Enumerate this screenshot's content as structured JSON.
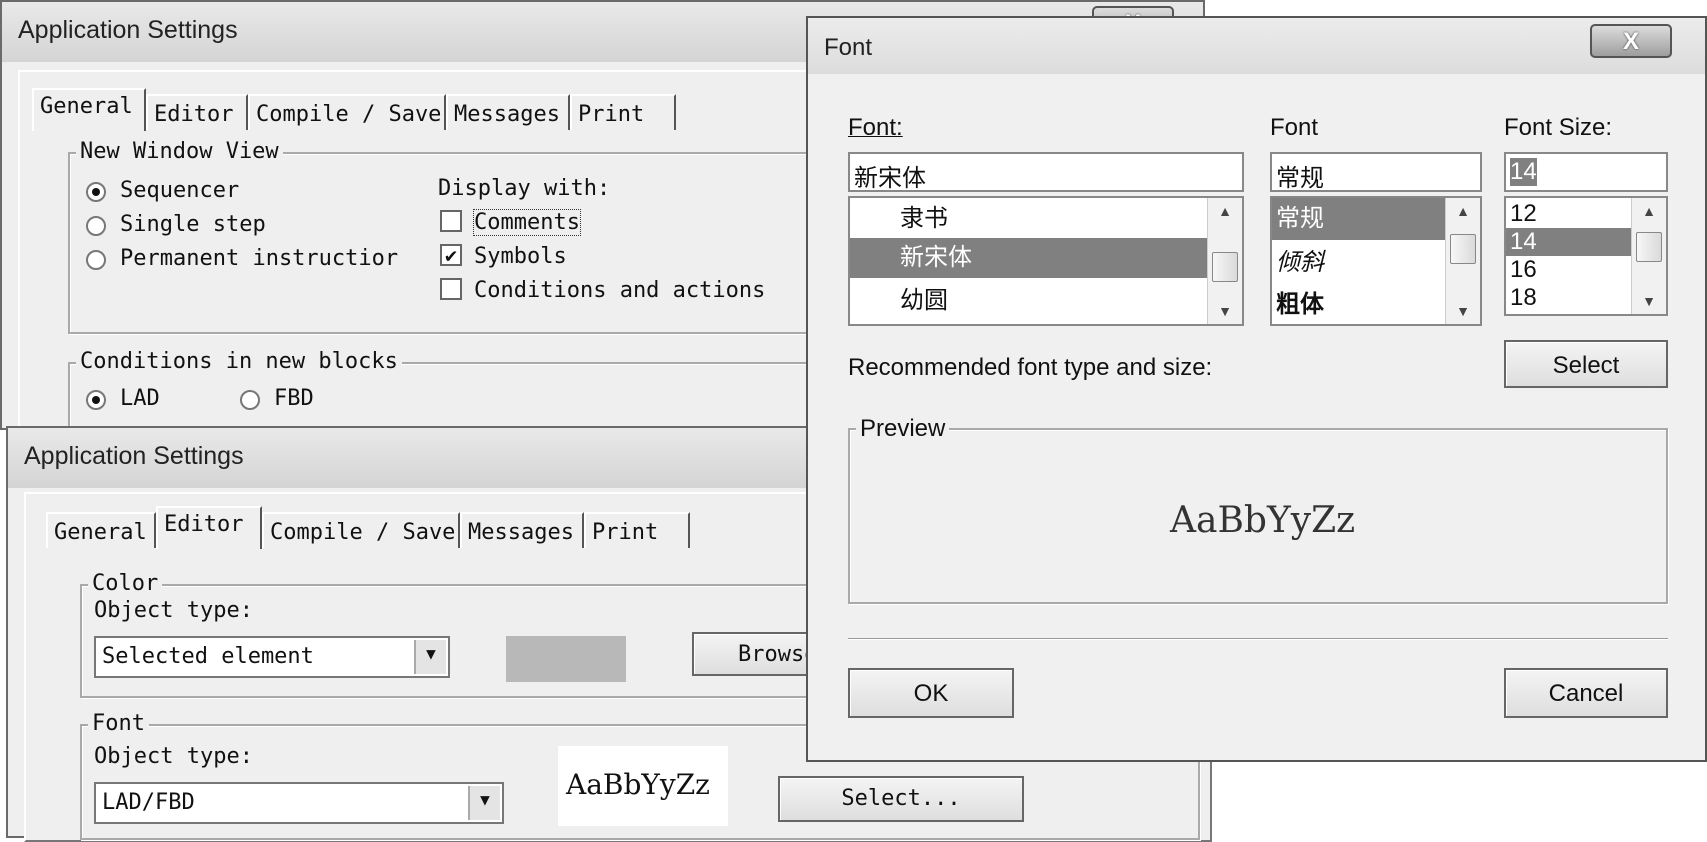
{
  "win1": {
    "title": "Application Settings",
    "tabs": [
      "General",
      "Editor",
      "Compile / Save",
      "Messages",
      "Print"
    ],
    "group_view": "New Window View",
    "radio_sequencer": "Sequencer",
    "radio_single": "Single step",
    "radio_permanent": "Permanent instructior",
    "display_with": "Display with:",
    "chk_comments": "Comments",
    "chk_symbols": "Symbols",
    "chk_conditions": "Conditions and actions",
    "group_conditions": "Conditions in new blocks",
    "radio_lad": "LAD",
    "radio_fbd": "FBD",
    "close": "X"
  },
  "win2": {
    "title": "Application Settings",
    "tabs": [
      "General",
      "Editor",
      "Compile / Save",
      "Messages",
      "Print"
    ],
    "group_color": "Color",
    "object_type_label": "Object type:",
    "color_object_value": "Selected element",
    "browse_button": "Browse...",
    "group_font": "Font",
    "font_object_label": "Object type:",
    "font_object_value": "LAD/FBD",
    "font_sample": "AaBbYyZz",
    "select_button": "Select..."
  },
  "font_dialog": {
    "title": "Font",
    "close": "X",
    "font_label": "Font:",
    "style_label": "Font",
    "size_label": "Font Size:",
    "font_value": "新宋体",
    "style_value": "常规",
    "size_value": "14",
    "font_list": [
      "隶书",
      "新宋体",
      "幼圆"
    ],
    "style_list": [
      "常规",
      "倾斜",
      "粗体"
    ],
    "size_list": [
      "12",
      "14",
      "16",
      "18"
    ],
    "recommended_label": "Recommended font type and size:",
    "select_button": "Select",
    "preview_label": "Preview",
    "preview_text": "AaBbYyZz",
    "ok_button": "OK",
    "cancel_button": "Cancel"
  }
}
